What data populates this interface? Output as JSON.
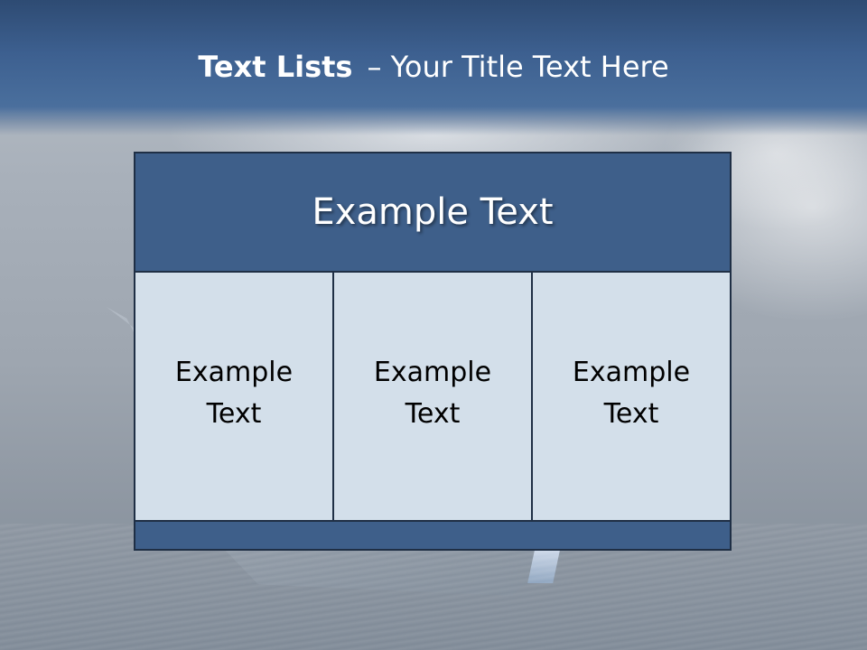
{
  "slide": {
    "title_bold": "Text Lists",
    "title_rest": "– Your Title Text Here"
  },
  "diagram": {
    "header": "Example Text",
    "items": [
      {
        "label": "Example Text"
      },
      {
        "label": "Example Text"
      },
      {
        "label": "Example Text"
      }
    ]
  },
  "colors": {
    "title_band": "#3d6090",
    "header_fill": "#3e5f8a",
    "cell_fill": "#d3dfea",
    "border": "#1f2f45"
  }
}
